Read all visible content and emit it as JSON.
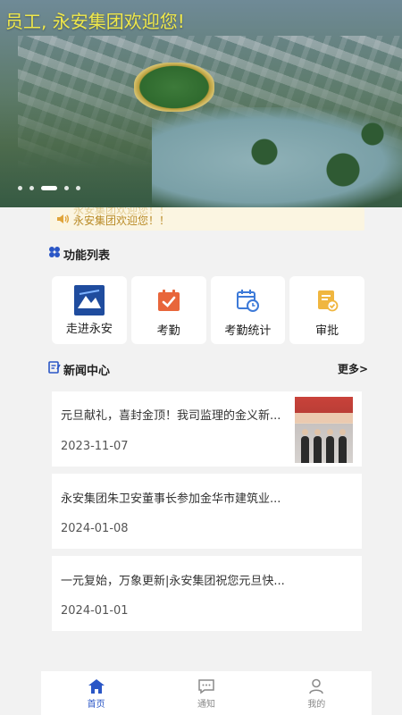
{
  "banner": {
    "title": "员工, 永安集团欢迎您!",
    "title_color": "#f0e84a",
    "slide_count": 5,
    "active_slide": 3
  },
  "notice": {
    "text": "永安集团欢迎您！！",
    "icon": "speaker-icon",
    "text_color": "#b98a25"
  },
  "functions": {
    "title": "功能列表",
    "icon": "grid-icon",
    "items": [
      {
        "label": "走进永安",
        "icon": "company-logo-icon"
      },
      {
        "label": "考勤",
        "icon": "calendar-check-icon"
      },
      {
        "label": "考勤统计",
        "icon": "calendar-clock-icon"
      },
      {
        "label": "审批",
        "icon": "document-approve-icon"
      }
    ]
  },
  "news": {
    "title": "新闻中心",
    "icon": "news-icon",
    "more_label": "更多>",
    "items": [
      {
        "title": "元旦献礼，喜封金顶！我司监理的金义新...",
        "date": "2023-11-07",
        "has_image": true
      },
      {
        "title": "永安集团朱卫安董事长参加金华市建筑业...",
        "date": "2024-01-08",
        "has_image": false
      },
      {
        "title": "一元复始，万象更新|永安集团祝您元旦快...",
        "date": "2024-01-01",
        "has_image": false
      }
    ]
  },
  "tabbar": {
    "items": [
      {
        "label": "首页",
        "icon": "home-icon",
        "active": true
      },
      {
        "label": "通知",
        "icon": "message-icon",
        "active": false
      },
      {
        "label": "我的",
        "icon": "user-icon",
        "active": false
      }
    ],
    "active_color": "#2a56c6",
    "inactive_color": "#8a8a8a"
  }
}
